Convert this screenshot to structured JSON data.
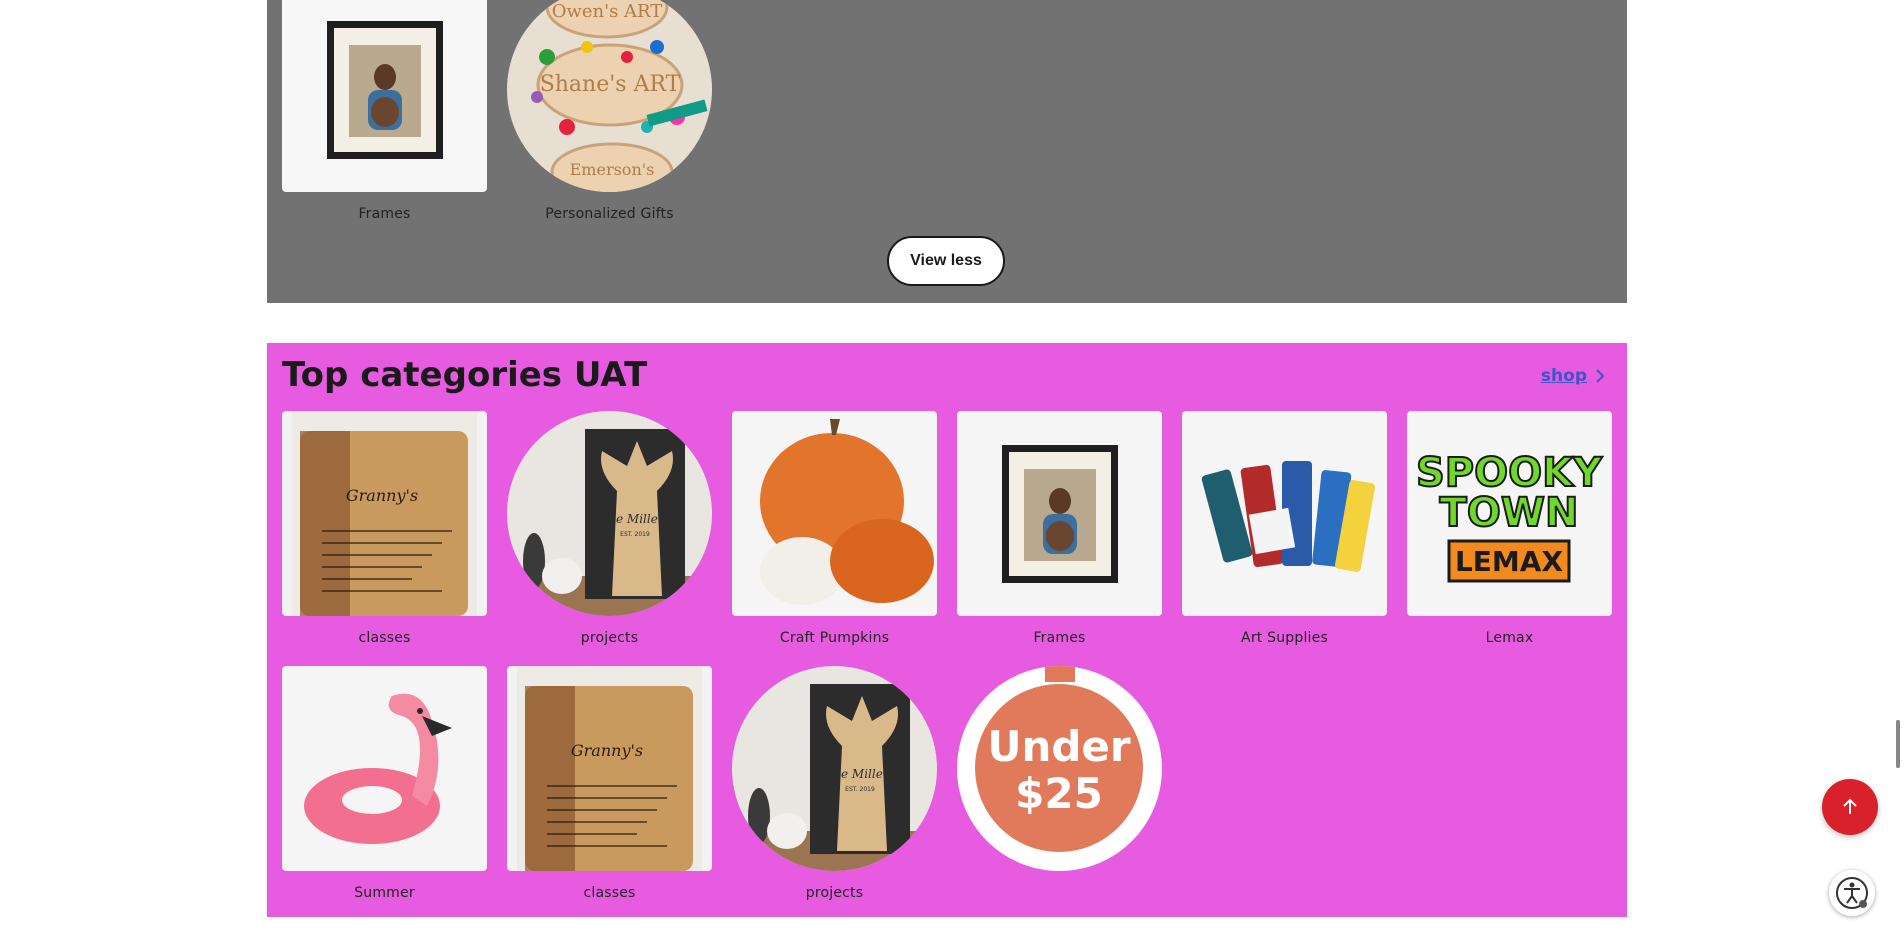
{
  "upper_section": {
    "items": [
      {
        "label": "Frames",
        "image": "framed-photo"
      },
      {
        "label": "Personalized Gifts",
        "image": "personalized-art-ornaments"
      }
    ],
    "view_less_label": "View less"
  },
  "top_categories": {
    "title": "Top categories UAT",
    "shop_label": "shop",
    "items": [
      {
        "label": "classes",
        "image": "cutting-board"
      },
      {
        "label": "projects",
        "image": "carved-tree-sign"
      },
      {
        "label": "Craft Pumpkins",
        "image": "pumpkins"
      },
      {
        "label": "Frames",
        "image": "framed-photo"
      },
      {
        "label": "Art Supplies",
        "image": "paint-tubes"
      },
      {
        "label": "Lemax",
        "image": "spooky-town-lemax-logo"
      },
      {
        "label": "Summer",
        "image": "flamingo-float"
      },
      {
        "label": "classes",
        "image": "cutting-board"
      },
      {
        "label": "projects",
        "image": "carved-tree-sign"
      },
      {
        "label": "",
        "image": "under-25-badge"
      }
    ]
  },
  "logo_text": {
    "cutting_board": "Granny's",
    "tree_sign_name": "The Millers",
    "tree_sign_est": "EST. 2019",
    "ornaments": [
      "Owen's ART",
      "Shane's ART",
      "Emerson's"
    ],
    "spooky_line1": "SPOOKY",
    "spooky_line2": "TOWN",
    "lemax": "LEMAX",
    "under_line1": "Under",
    "under_line2": "$25"
  },
  "colors": {
    "upper_bg": "#727272",
    "categories_bg": "#e65be0",
    "back_to_top": "#d8212b",
    "link": "#3b56c8"
  },
  "icons": {
    "shop_arrow": "chevron-right-icon",
    "back_to_top": "arrow-up-icon",
    "accessibility": "accessibility-icon"
  }
}
